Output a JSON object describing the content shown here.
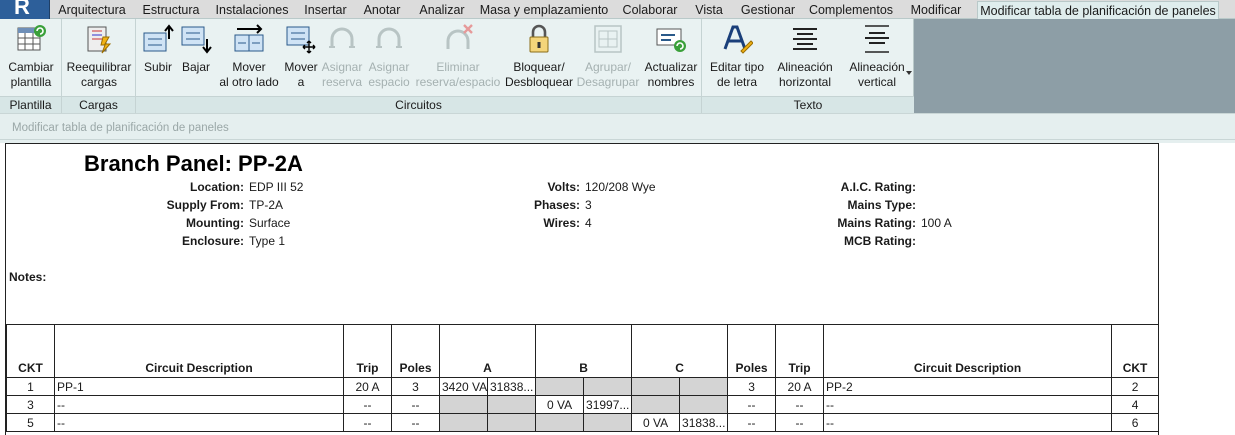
{
  "app": {
    "button_glyph": "R"
  },
  "tabs": [
    {
      "label": "Arquitectura",
      "active": false
    },
    {
      "label": "Estructura",
      "active": false
    },
    {
      "label": "Instalaciones",
      "active": false
    },
    {
      "label": "Insertar",
      "active": false
    },
    {
      "label": "Anotar",
      "active": false
    },
    {
      "label": "Analizar",
      "active": false
    },
    {
      "label": "Masa y emplazamiento",
      "active": false
    },
    {
      "label": "Colaborar",
      "active": false
    },
    {
      "label": "Vista",
      "active": false
    },
    {
      "label": "Gestionar",
      "active": false
    },
    {
      "label": "Complementos",
      "active": false
    },
    {
      "label": "Modificar",
      "active": false
    },
    {
      "label": "Modificar tabla de planificación de paneles",
      "active": true
    }
  ],
  "ribbon": {
    "panels": {
      "plantilla": "Plantilla",
      "cargas": "Cargas",
      "circuitos": "Circuitos",
      "texto": "Texto"
    },
    "buttons": {
      "cambiar_plantilla": [
        "Cambiar",
        "plantilla"
      ],
      "reequilibrar_cargas": [
        "Reequilibrar",
        "cargas"
      ],
      "subir": [
        "Subir",
        ""
      ],
      "bajar": [
        "Bajar",
        ""
      ],
      "mover_al_otro_lado": [
        "Mover",
        "al otro lado"
      ],
      "mover_a": [
        "Mover",
        "a"
      ],
      "asignar_reserva": [
        "Asignar",
        "reserva"
      ],
      "asignar_espacio": [
        "Asignar",
        "espacio"
      ],
      "eliminar_reserva_espacio": [
        "Eliminar",
        "reserva/espacio"
      ],
      "bloquear": [
        "Bloquear/",
        "Desbloquear"
      ],
      "agrupar": [
        "Agrupar/",
        "Desagrupar"
      ],
      "actualizar_nombres": [
        "Actualizar",
        "nombres"
      ],
      "editar_tipo_letra": [
        "Editar tipo",
        "de letra"
      ],
      "alineacion_horizontal": [
        "Alineación",
        "horizontal"
      ],
      "alineacion_vertical": [
        "Alineación",
        "vertical"
      ]
    }
  },
  "subheader": {
    "text": "Modificar tabla de planificación de paneles"
  },
  "schedule": {
    "title": "Branch Panel: PP-2A",
    "left": [
      {
        "key": "Location:",
        "value": "EDP III 52"
      },
      {
        "key": "Supply From:",
        "value": "TP-2A"
      },
      {
        "key": "Mounting:",
        "value": "Surface"
      },
      {
        "key": "Enclosure:",
        "value": "Type 1"
      }
    ],
    "mid": [
      {
        "key": "Volts:",
        "value": "120/208 Wye"
      },
      {
        "key": "Phases:",
        "value": "3"
      },
      {
        "key": "Wires:",
        "value": "4"
      }
    ],
    "right": [
      {
        "key": "A.I.C. Rating:",
        "value": ""
      },
      {
        "key": "Mains Type:",
        "value": ""
      },
      {
        "key": "Mains Rating:",
        "value": "100 A"
      },
      {
        "key": "MCB Rating:",
        "value": ""
      }
    ],
    "notes_label": "Notes:",
    "columns": {
      "ckt": "CKT",
      "desc": "Circuit Description",
      "trip": "Trip",
      "poles": "Poles",
      "a": "A",
      "b": "B",
      "c": "C"
    },
    "rows": [
      {
        "ckt_l": "1",
        "desc_l": "PP-1",
        "trip_l": "20 A",
        "poles_l": "3",
        "a1": "3420 VA",
        "a2": "31838...",
        "b1": "",
        "b2": "",
        "c1": "",
        "c2": "",
        "poles_r": "3",
        "trip_r": "20 A",
        "desc_r": "PP-2",
        "ckt_r": "2"
      },
      {
        "ckt_l": "3",
        "desc_l": "--",
        "trip_l": "--",
        "poles_l": "--",
        "a1": "",
        "a2": "",
        "b1": "0 VA",
        "b2": "31997...",
        "c1": "",
        "c2": "",
        "poles_r": "--",
        "trip_r": "--",
        "desc_r": "--",
        "ckt_r": "4"
      },
      {
        "ckt_l": "5",
        "desc_l": "--",
        "trip_l": "--",
        "poles_l": "--",
        "a1": "",
        "a2": "",
        "b1": "",
        "b2": "",
        "c1": "0 VA",
        "c2": "31838...",
        "poles_r": "--",
        "trip_r": "--",
        "desc_r": "--",
        "ckt_r": "6"
      }
    ]
  }
}
